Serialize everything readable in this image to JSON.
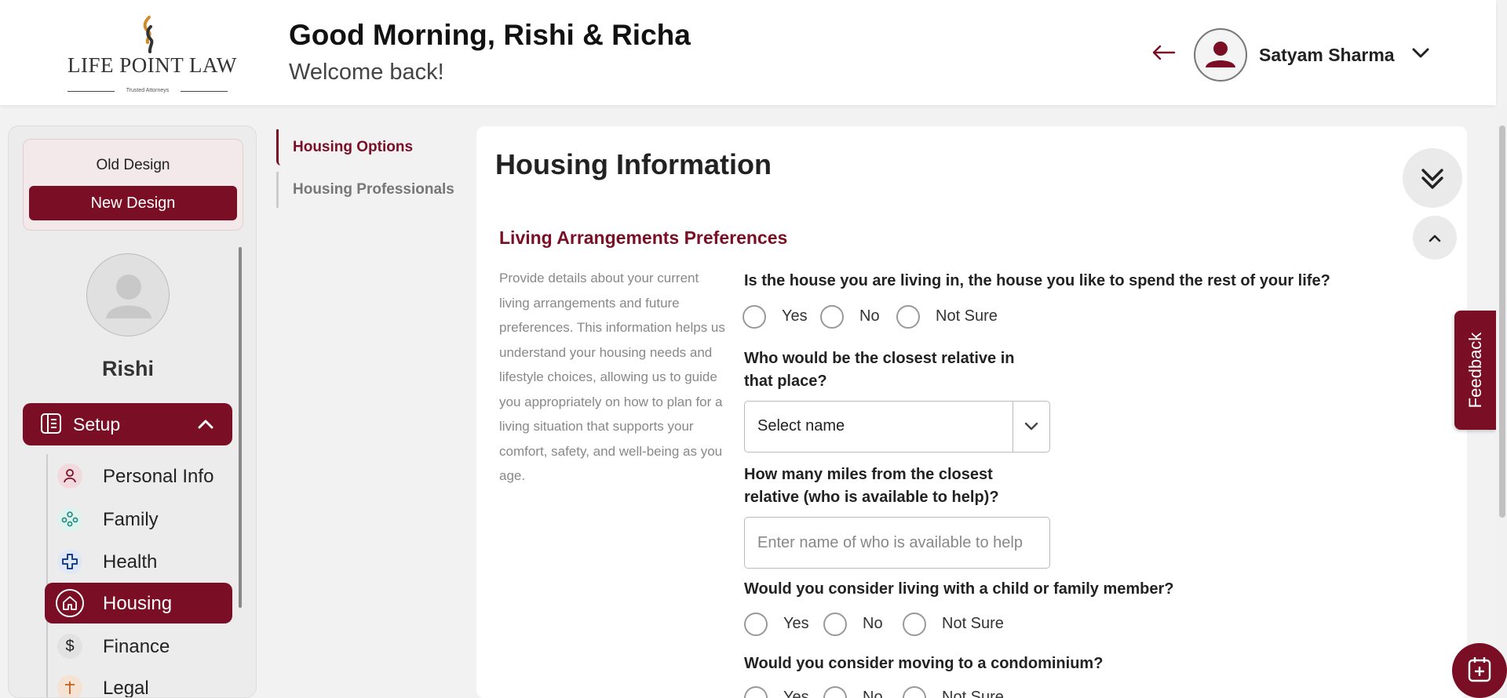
{
  "header": {
    "brand": "LIFE POINT LAW",
    "tagline": "Trusted Attorneys",
    "greeting": "Good Morning, Rishi & Richa",
    "subgreeting": "Welcome back!",
    "user_name": "Satyam Sharma"
  },
  "sidebar": {
    "old_design": "Old Design",
    "new_design": "New Design",
    "profile_name": "Rishi",
    "setup_label": "Setup",
    "items": [
      {
        "label": "Personal Info",
        "icon": "person-icon",
        "active": false
      },
      {
        "label": "Family",
        "icon": "family-icon",
        "active": false
      },
      {
        "label": "Health",
        "icon": "health-cross-icon",
        "active": false
      },
      {
        "label": "Housing",
        "icon": "house-icon",
        "active": true
      },
      {
        "label": "Finance",
        "icon": "dollar-icon",
        "active": false
      },
      {
        "label": "Legal",
        "icon": "legal-icon",
        "active": false
      }
    ]
  },
  "subnav": {
    "items": [
      {
        "label": "Housing Options",
        "active": true
      },
      {
        "label": "Housing Professionals",
        "active": false
      }
    ]
  },
  "main": {
    "title": "Housing Information",
    "section_title": "Living Arrangements Preferences",
    "section_desc": "Provide details about your current living arrangements and future preferences. This information helps us understand your housing needs and lifestyle choices, allowing us to guide you appropriately on how to plan for a living situation that supports your comfort, safety, and well-being as you age.",
    "q1": "Is the house you are living in, the house you like to spend the rest of your life?",
    "q2_line1": "Who would be the closest relative in",
    "q2_line2": "that place?",
    "select_value": "Select name",
    "q3_line1": "How many miles from the closest",
    "q3_line2": "relative (who is available to help)?",
    "input_placeholder": "Enter name of who is available to help",
    "q4": "Would you consider living with a child or family member?",
    "q5": "Would you consider moving to a condominium?",
    "options": {
      "yes": "Yes",
      "no": "No",
      "not_sure": "Not Sure"
    }
  },
  "feedback_label": "Feedback",
  "colors": {
    "brand": "#7a0e25",
    "background": "#f2f2f2"
  }
}
